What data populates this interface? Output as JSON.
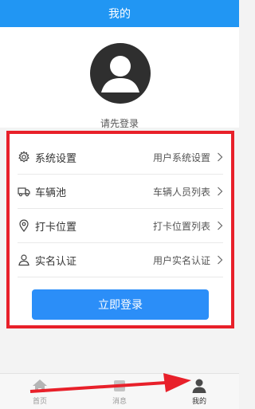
{
  "header": {
    "title": "我的"
  },
  "profile": {
    "avatar_icon": "user-avatar-icon",
    "login_prompt": "请先登录"
  },
  "menu": [
    {
      "icon": "gear-icon",
      "label": "系统设置",
      "value": "用户系统设置"
    },
    {
      "icon": "truck-icon",
      "label": "车辆池",
      "value": "车辆人员列表"
    },
    {
      "icon": "location-pin-icon",
      "label": "打卡位置",
      "value": "打卡位置列表"
    },
    {
      "icon": "person-icon",
      "label": "实名认证",
      "value": "用户实名认证"
    }
  ],
  "login_button": "立即登录",
  "tabbar": {
    "items": [
      {
        "icon": "home-icon",
        "label": "首页"
      },
      {
        "icon": "message-icon",
        "label": "消息"
      },
      {
        "icon": "profile-icon",
        "label": "我的"
      }
    ],
    "active": 2
  },
  "colors": {
    "header_bg": "#2196f3",
    "button_bg": "#2b8ef8",
    "highlight_border": "#e8202a",
    "arrow": "#e8202a"
  }
}
